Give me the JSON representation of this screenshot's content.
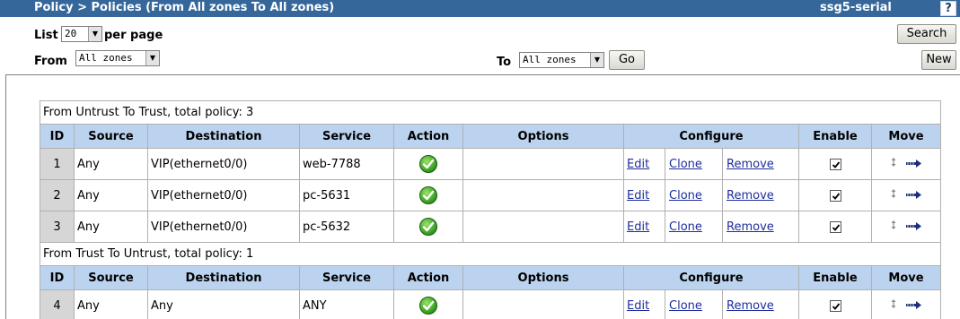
{
  "header": {
    "title": "Policy > Policies (From All zones To All zones)",
    "device": "ssg5-serial",
    "help_label": "?"
  },
  "controls": {
    "list_label": "List",
    "per_page_value": "20",
    "per_page_label": "per page",
    "from_label": "From",
    "from_value": "All zones",
    "to_label": "To",
    "to_value": "All zones",
    "go_label": "Go",
    "search_label": "Search",
    "new_label": "New"
  },
  "columns": [
    "ID",
    "Source",
    "Destination",
    "Service",
    "Action",
    "Options",
    "Configure",
    "Enable",
    "Move"
  ],
  "groups": [
    {
      "heading": "From Untrust To Trust, total policy: 3",
      "rows": [
        {
          "id": "1",
          "source": "Any",
          "destination": "VIP(ethernet0/0)",
          "service": "web-7788",
          "options": "",
          "edit": "Edit",
          "clone": "Clone",
          "remove": "Remove",
          "enabled": true
        },
        {
          "id": "2",
          "source": "Any",
          "destination": "VIP(ethernet0/0)",
          "service": "pc-5631",
          "options": "",
          "edit": "Edit",
          "clone": "Clone",
          "remove": "Remove",
          "enabled": true
        },
        {
          "id": "3",
          "source": "Any",
          "destination": "VIP(ethernet0/0)",
          "service": "pc-5632",
          "options": "",
          "edit": "Edit",
          "clone": "Clone",
          "remove": "Remove",
          "enabled": true
        }
      ]
    },
    {
      "heading": "From Trust To Untrust, total policy: 1",
      "rows": [
        {
          "id": "4",
          "source": "Any",
          "destination": "Any",
          "service": "ANY",
          "options": "",
          "edit": "Edit",
          "clone": "Clone",
          "remove": "Remove",
          "enabled": true
        }
      ]
    }
  ],
  "icons": {
    "action": "permit-check-icon",
    "enable": "checkbox-checked-icon",
    "move_swap": "swap-updown-icon",
    "move_arrow": "move-right-arrow-icon"
  },
  "colors": {
    "titlebar": "#36679a",
    "header_row": "#bcd3ef",
    "id_cell": "#d6d6d6",
    "link": "#1e2d9e"
  }
}
